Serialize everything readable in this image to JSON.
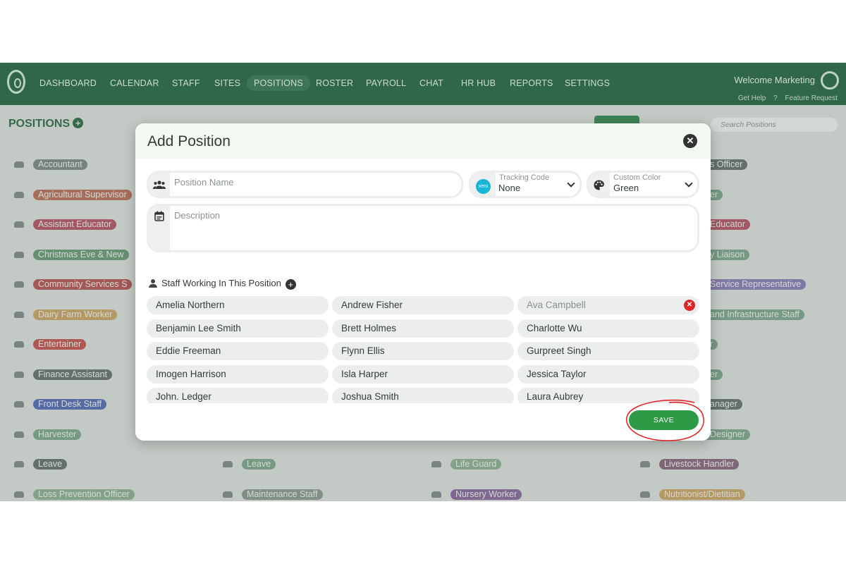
{
  "nav": {
    "items": [
      "DASHBOARD",
      "CALENDAR",
      "STAFF",
      "SITES",
      "POSITIONS",
      "ROSTER",
      "PAYROLL",
      "CHAT",
      "HR HUB",
      "REPORTS",
      "SETTINGS"
    ],
    "active": "POSITIONS",
    "welcome": "Welcome Marketing",
    "help": "Get Help",
    "feature_request": "Feature Request"
  },
  "background": {
    "title": "POSITIONS",
    "search_placeholder": "Search Positions",
    "positions": [
      {
        "label": "Accountant",
        "color": "#7f8b85"
      },
      {
        "label": "Agricultural Supervisor",
        "color": "#b7735f"
      },
      {
        "label": "Assistant Educator",
        "color": "#b25a6a"
      },
      {
        "label": "Christmas Eve & New",
        "color": "#6e9a78"
      },
      {
        "label": "Community Services S",
        "color": "#b25a5a"
      },
      {
        "label": "Dairy Farm Worker",
        "color": "#c7a46a"
      },
      {
        "label": "Entertainer",
        "color": "#c05a56"
      },
      {
        "label": "Finance Assistant",
        "color": "#6b7671"
      },
      {
        "label": "Front Desk Staff",
        "color": "#5a6fb2"
      },
      {
        "label": "Harvester",
        "color": "#7fa58e"
      },
      {
        "label": "Leave",
        "color": "#6b7671"
      },
      {
        "label": "Loss Prevention Officer",
        "color": "#8fae95"
      },
      {
        "label": "Leave",
        "color": "#7fa58e"
      },
      {
        "label": "Maintenance Staff",
        "color": "#8b9a91"
      },
      {
        "label": "Life Guard",
        "color": "#8fae95"
      },
      {
        "label": "Nursery Worker",
        "color": "#8a6b9a"
      },
      {
        "label": "Livestock Handler",
        "color": "#8a6b7f"
      },
      {
        "label": "Nutritionist/Dietitian",
        "color": "#c7a46a"
      }
    ],
    "right_fragments": [
      {
        "label": "s Officer",
        "color": "#6b7671"
      },
      {
        "label": "er",
        "color": "#7fa58e"
      },
      {
        "label": "Educator",
        "color": "#b25a6a"
      },
      {
        "label": "y Liaison",
        "color": "#7fa58e"
      },
      {
        "label": "Service Representative",
        "color": "#8a7fb2"
      },
      {
        "label": "and Infrastructure Staff",
        "color": "#7fa58e"
      },
      {
        "label": "r",
        "color": "#7fa58e"
      },
      {
        "label": "er",
        "color": "#7fa58e"
      },
      {
        "label": "anager",
        "color": "#6b7671"
      },
      {
        "label": "Designer",
        "color": "#7fa58e"
      }
    ]
  },
  "modal": {
    "title": "Add Position",
    "close_icon": "close-icon",
    "position_name_placeholder": "Position Name",
    "tracking_code_label": "Tracking Code",
    "tracking_code_value": "None",
    "xero_badge": "xero",
    "custom_color_label": "Custom Color",
    "custom_color_value": "Green",
    "description_placeholder": "Description",
    "staff_heading": "Staff Working In This Position",
    "staff": [
      {
        "name": "Amelia Northern",
        "state": "normal"
      },
      {
        "name": "Andrew Fisher",
        "state": "normal"
      },
      {
        "name": "Ava Campbell",
        "state": "removable"
      },
      {
        "name": "Benjamin Lee Smith",
        "state": "normal"
      },
      {
        "name": "Brett Holmes",
        "state": "normal"
      },
      {
        "name": "Charlotte Wu",
        "state": "normal"
      },
      {
        "name": "Eddie Freeman",
        "state": "normal"
      },
      {
        "name": "Flynn Ellis",
        "state": "normal"
      },
      {
        "name": "Gurpreet Singh",
        "state": "normal"
      },
      {
        "name": "Imogen Harrison",
        "state": "normal"
      },
      {
        "name": "Isla Harper",
        "state": "normal"
      },
      {
        "name": "Jessica Taylor",
        "state": "normal"
      },
      {
        "name": "John. Ledger",
        "state": "normal"
      },
      {
        "name": "Joshua Smith",
        "state": "normal"
      },
      {
        "name": "Laura Aubrey",
        "state": "normal"
      }
    ],
    "save_label": "SAVE"
  },
  "colors": {
    "nav_bg": "#2f6b4a",
    "save_green": "#2e9a45",
    "remove_red": "#dc2626",
    "annotation_red": "#e0252b"
  }
}
